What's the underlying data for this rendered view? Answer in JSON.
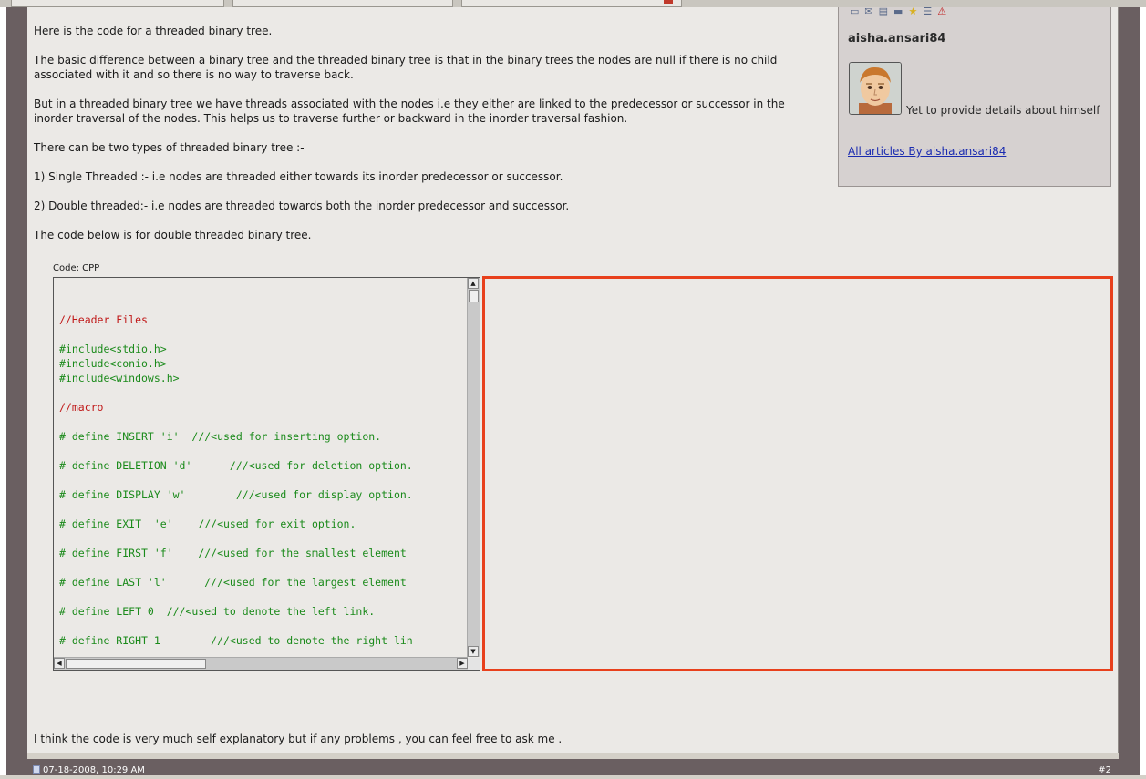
{
  "post": {
    "paragraphs": [
      "Here is the code for a threaded binary tree.",
      "The basic difference between a binary tree and the threaded binary tree is that in the binary trees the nodes are null if there is no child associated with it and so there is no way to traverse back.",
      "But in a threaded binary tree we have threads associated with the nodes i.e they either are linked to the predecessor or successor in the inorder traversal of the nodes. This helps us to traverse further or backward in the inorder traversal fashion.",
      "There can be two types of threaded binary tree :-",
      "1) Single Threaded :- i.e nodes are threaded either towards its inorder predecessor or successor.",
      "2) Double threaded:- i.e nodes are threaded towards both the inorder predecessor and successor.",
      "The code below is for double threaded binary tree."
    ],
    "closing": "I think the code is very much self explanatory but if any problems , you can feel free to ask me ."
  },
  "code": {
    "label": "Code: CPP",
    "lines": [
      {
        "text": "//Header Files",
        "kind": "comment"
      },
      {
        "text": "",
        "kind": "blank"
      },
      {
        "text": "#include<stdio.h>",
        "kind": "pre"
      },
      {
        "text": "#include<conio.h>",
        "kind": "pre"
      },
      {
        "text": "#include<windows.h>",
        "kind": "pre"
      },
      {
        "text": "",
        "kind": "blank"
      },
      {
        "text": "//macro",
        "kind": "comment"
      },
      {
        "text": "",
        "kind": "blank"
      },
      {
        "text": "# define INSERT 'i'  ///<used for inserting option.",
        "kind": "pre"
      },
      {
        "text": "",
        "kind": "blank"
      },
      {
        "text": "# define DELETION 'd'      ///<used for deletion option.",
        "kind": "pre"
      },
      {
        "text": "",
        "kind": "blank"
      },
      {
        "text": "# define DISPLAY 'w'        ///<used for display option.",
        "kind": "pre"
      },
      {
        "text": "",
        "kind": "blank"
      },
      {
        "text": "# define EXIT  'e'    ///<used for exit option.",
        "kind": "pre"
      },
      {
        "text": "",
        "kind": "blank"
      },
      {
        "text": "# define FIRST 'f'    ///<used for the smallest element",
        "kind": "pre"
      },
      {
        "text": "",
        "kind": "blank"
      },
      {
        "text": "# define LAST 'l'      ///<used for the largest element",
        "kind": "pre"
      },
      {
        "text": "",
        "kind": "blank"
      },
      {
        "text": "# define LEFT 0  ///<used to denote the left link.",
        "kind": "pre"
      },
      {
        "text": "",
        "kind": "blank"
      },
      {
        "text": "# define RIGHT 1        ///<used to denote the right lin",
        "kind": "pre"
      }
    ]
  },
  "author": {
    "name": "aisha.ansari84",
    "description": "Yet to provide details about himself",
    "articles_link": "All articles By aisha.ansari84",
    "icons": [
      "profile-icon",
      "message-icon",
      "blog-icon",
      "car-icon",
      "star-icon",
      "list-icon",
      "warning-icon"
    ]
  },
  "next_post": {
    "date": "07-18-2008, 10:29 AM",
    "number": "#2"
  },
  "colors": {
    "comment": "#c01818",
    "preprocessor": "#1a8a1a",
    "highlight": "#e8401c",
    "link": "#1a2bb0"
  }
}
